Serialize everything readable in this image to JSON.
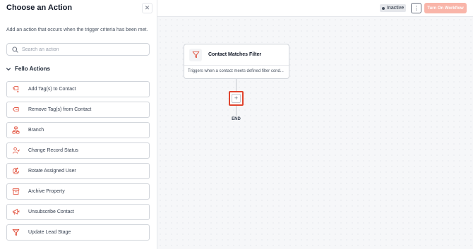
{
  "panel": {
    "title": "Choose an Action",
    "close_icon": "close-icon",
    "description": "Add an action that occurs when the trigger criteria has been met.",
    "search_placeholder": "Search an action",
    "group_label": "Fello Actions",
    "actions": [
      {
        "label": "Add Tag(s) to Contact",
        "icon": "tag-plus-icon"
      },
      {
        "label": "Remove Tag(s) from Contact",
        "icon": "tag-minus-icon"
      },
      {
        "label": "Branch",
        "icon": "branch-icon"
      },
      {
        "label": "Change Record Status",
        "icon": "user-status-icon"
      },
      {
        "label": "Rotate Assigned User",
        "icon": "rotate-user-icon"
      },
      {
        "label": "Archive Property",
        "icon": "archive-icon"
      },
      {
        "label": "Unsubscribe Contact",
        "icon": "megaphone-off-icon"
      },
      {
        "label": "Update Lead Stage",
        "icon": "funnel-icon"
      }
    ]
  },
  "topbar": {
    "status": "Inactive",
    "more_label": "⋮",
    "turn_on_label": "Turn On Workflow"
  },
  "canvas": {
    "trigger_title": "Contact Matches Filter",
    "trigger_desc": "Triggers when a contact meets defined filter cond...",
    "add_label": "+",
    "end_label": "END"
  },
  "colors": {
    "accent": "#e0442e",
    "accent_light": "#f9b5a9"
  }
}
